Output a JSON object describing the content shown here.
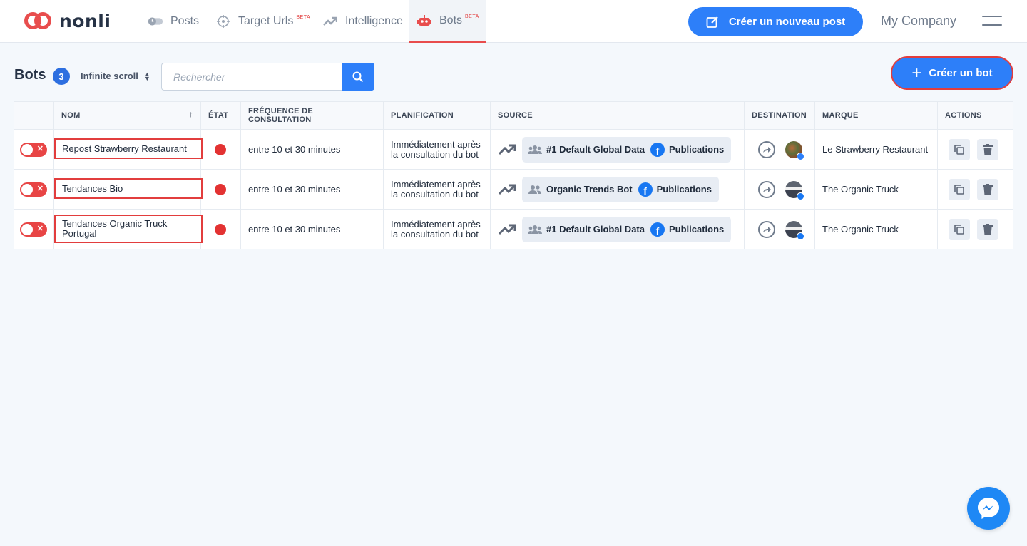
{
  "app": {
    "logo_text": "nonli",
    "colors": {
      "accent": "#2d7ff9",
      "danger": "#e23d3d",
      "nav_active_border": "#e84d4d"
    }
  },
  "nav": {
    "items": [
      {
        "label": "Posts",
        "icon": "posts-toggle-icon",
        "beta": ""
      },
      {
        "label": "Target Urls",
        "icon": "crosshair-icon",
        "beta": "BETA"
      },
      {
        "label": "Intelligence",
        "icon": "trend-icon",
        "beta": ""
      },
      {
        "label": "Bots",
        "icon": "robot-icon",
        "beta": "BETA",
        "active": true
      }
    ],
    "new_post_label": "Créer un nouveau post",
    "company": "My Company"
  },
  "toolbar": {
    "title": "Bots",
    "count": "3",
    "scroll_mode": "Infinite scroll",
    "search_placeholder": "Rechercher",
    "search_value": "",
    "create_bot_label": "Créer un bot"
  },
  "table": {
    "headers": {
      "name": "NOM",
      "state": "ÉTAT",
      "frequency": "FRÉQUENCE DE CONSULTATION",
      "planning": "PLANIFICATION",
      "source": "SOURCE",
      "destination": "DESTINATION",
      "brand": "MARQUE",
      "actions": "ACTIONS"
    },
    "rows": [
      {
        "enabled": false,
        "name": "Repost Strawberry Restaurant",
        "state_color": "#e33232",
        "frequency": "entre 10 et 30 minutes",
        "planning_line1": "Immédiatement après",
        "planning_line2": "la consultation du bot",
        "source_name": "#1 Default Global Data",
        "source_channel": "Publications",
        "destination_avatar": "food-avatar",
        "brand": "Le Strawberry Restaurant"
      },
      {
        "enabled": false,
        "name": "Tendances Bio",
        "state_color": "#e33232",
        "frequency": "entre 10 et 30 minutes",
        "planning_line1": "Immédiatement après",
        "planning_line2": "la consultation du bot",
        "source_name": "Organic Trends Bot",
        "source_channel": "Publications",
        "destination_avatar": "truck-avatar",
        "brand": "The Organic Truck"
      },
      {
        "enabled": false,
        "name_line1": "Tendances Organic Truck",
        "name_line2": "Portugal",
        "state_color": "#e33232",
        "frequency": "entre 10 et 30 minutes",
        "planning_line1": "Immédiatement après",
        "planning_line2": "la consultation du bot",
        "source_name": "#1 Default Global Data",
        "source_channel": "Publications",
        "destination_avatar": "truck-avatar",
        "brand": "The Organic Truck"
      }
    ]
  }
}
